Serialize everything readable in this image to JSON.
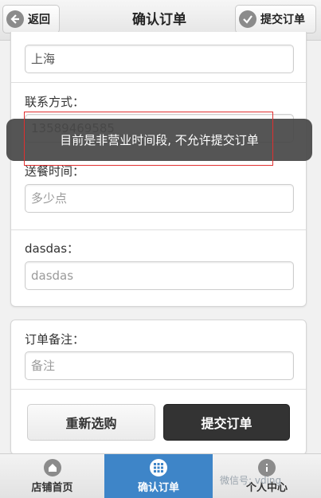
{
  "header": {
    "back_label": "返回",
    "title": "确认订单",
    "submit_label": "提交订单"
  },
  "form": {
    "address_value": "上海",
    "contact_label": "联系方式：",
    "contact_value": "13589469585",
    "delivery_time_label": "送餐时间：",
    "delivery_time_placeholder": "多少点",
    "custom_label": "dasdas：",
    "custom_placeholder": "dasdas",
    "remark_label": "订单备注：",
    "remark_placeholder": "备注"
  },
  "actions": {
    "reset_label": "重新选购",
    "submit_label": "提交订单"
  },
  "toast": {
    "message": "目前是非营业时间段, 不允许提交订单"
  },
  "nav": {
    "items": [
      {
        "label": "店铺首页",
        "icon": "home-icon"
      },
      {
        "label": "确认订单",
        "icon": "grid-icon",
        "active": true
      },
      {
        "label": "个人中心",
        "icon": "info-icon"
      }
    ]
  },
  "watermark": "微信号: vding",
  "colors": {
    "accent": "#3e85c8",
    "toast_bg": "#464646",
    "primary_button": "#333333"
  }
}
